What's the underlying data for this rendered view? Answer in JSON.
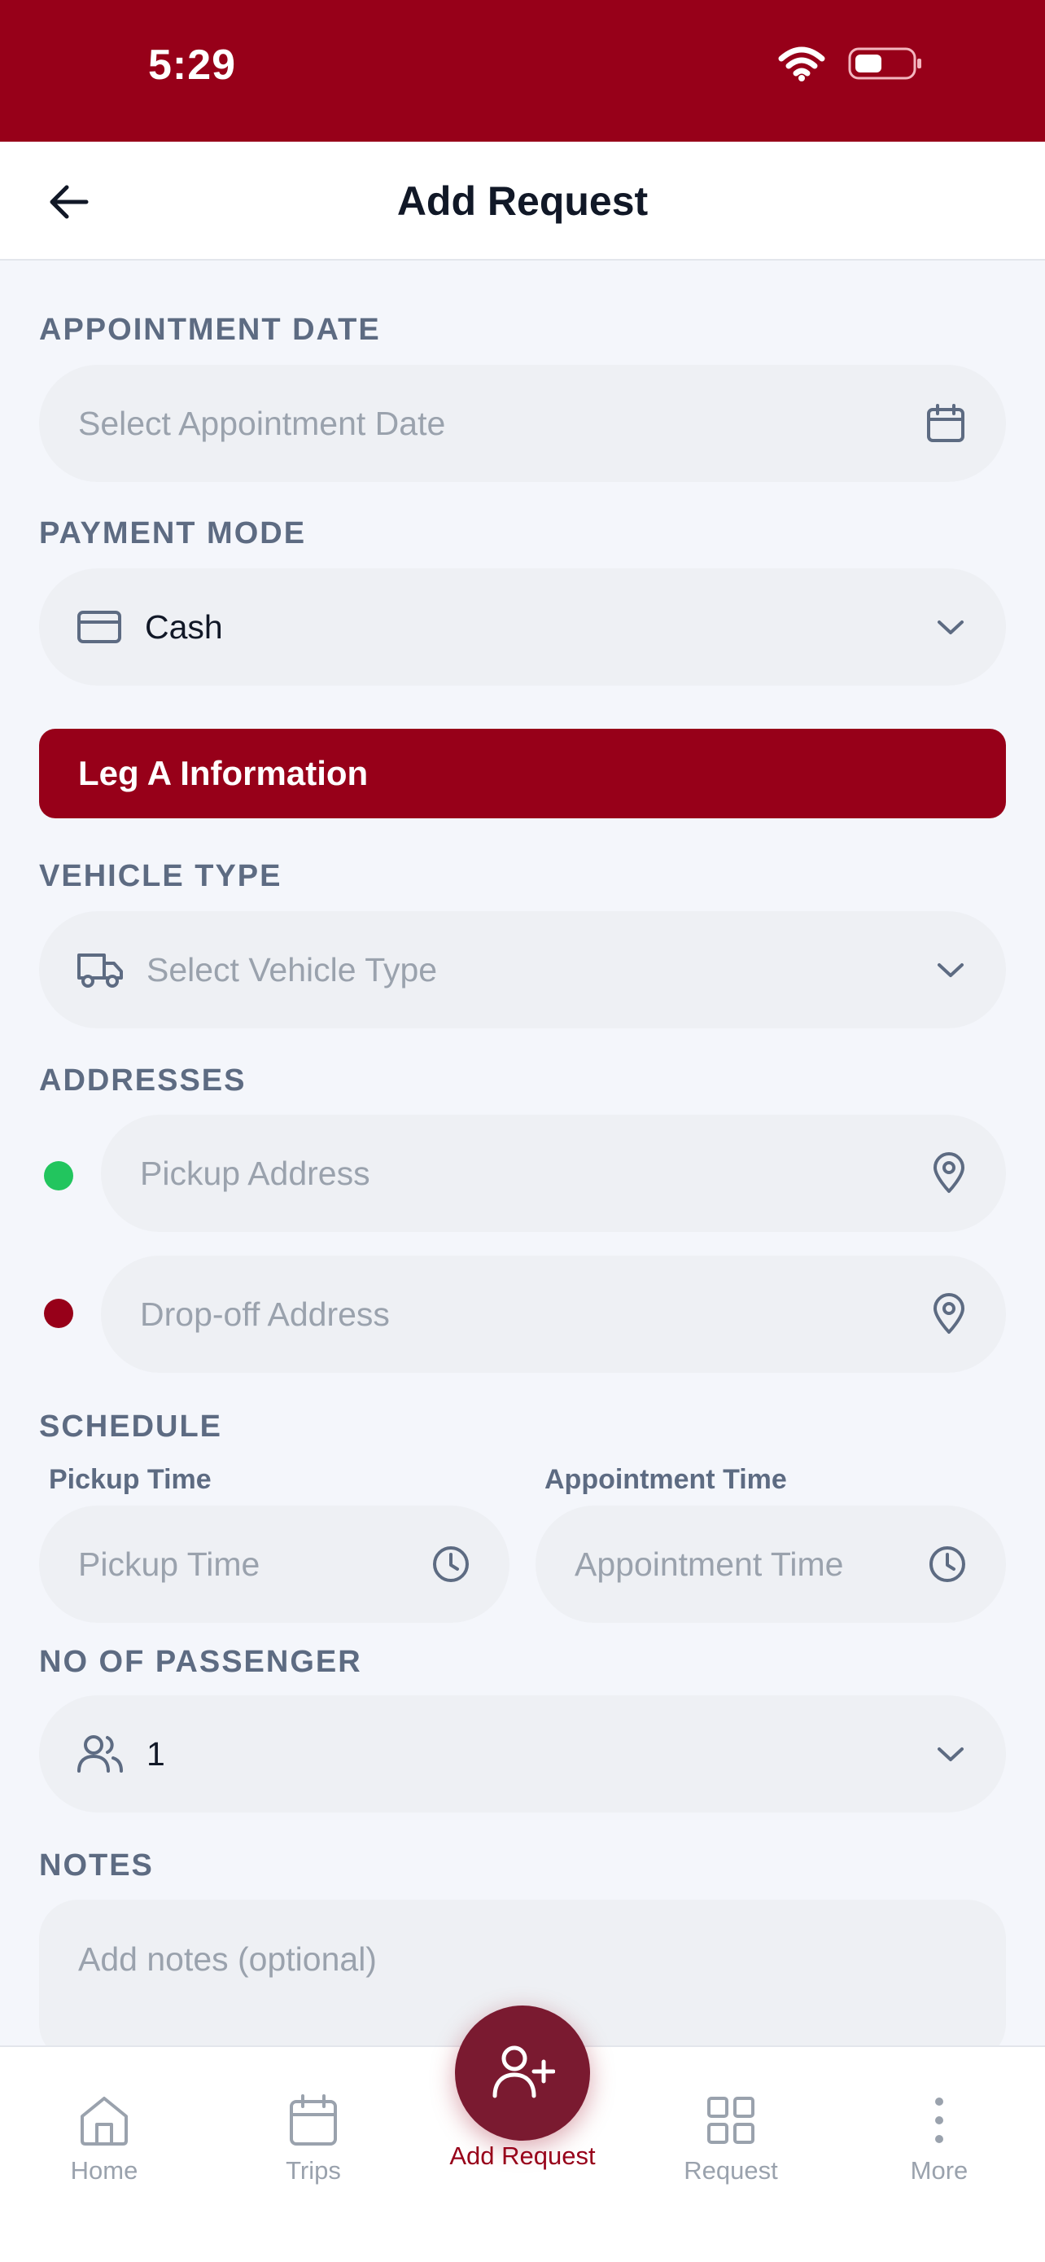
{
  "status_bar": {
    "time": "5:29"
  },
  "header": {
    "title": "Add Request"
  },
  "appointment_date": {
    "label": "APPOINTMENT DATE",
    "placeholder": "Select Appointment Date"
  },
  "payment_mode": {
    "label": "PAYMENT MODE",
    "value": "Cash"
  },
  "leg_a": {
    "title": "Leg A Information"
  },
  "vehicle_type": {
    "label": "VEHICLE TYPE",
    "placeholder": "Select Vehicle Type"
  },
  "addresses": {
    "label": "ADDRESSES",
    "pickup_placeholder": "Pickup Address",
    "dropoff_placeholder": "Drop-off Address"
  },
  "schedule": {
    "label": "SCHEDULE",
    "pickup_label": "Pickup Time",
    "pickup_placeholder": "Pickup Time",
    "appointment_label": "Appointment Time",
    "appointment_placeholder": "Appointment Time"
  },
  "passengers": {
    "label": "NO OF PASSENGER",
    "value": "1"
  },
  "notes": {
    "label": "NOTES",
    "placeholder": "Add notes (optional)"
  },
  "bottom_nav": {
    "home": "Home",
    "trips": "Trips",
    "add_request": "Add Request",
    "request": "Request",
    "more": "More"
  },
  "colors": {
    "brand": "#970019",
    "pickup_dot": "#22c55e",
    "dropoff_dot": "#970019"
  },
  "icons": {
    "back": "arrow-left-icon",
    "calendar": "calendar-icon",
    "card": "credit-card-icon",
    "truck": "truck-icon",
    "pin": "map-pin-icon",
    "clock": "clock-icon",
    "users": "users-icon",
    "chevron": "chevron-down-icon",
    "fab": "user-plus-icon"
  }
}
